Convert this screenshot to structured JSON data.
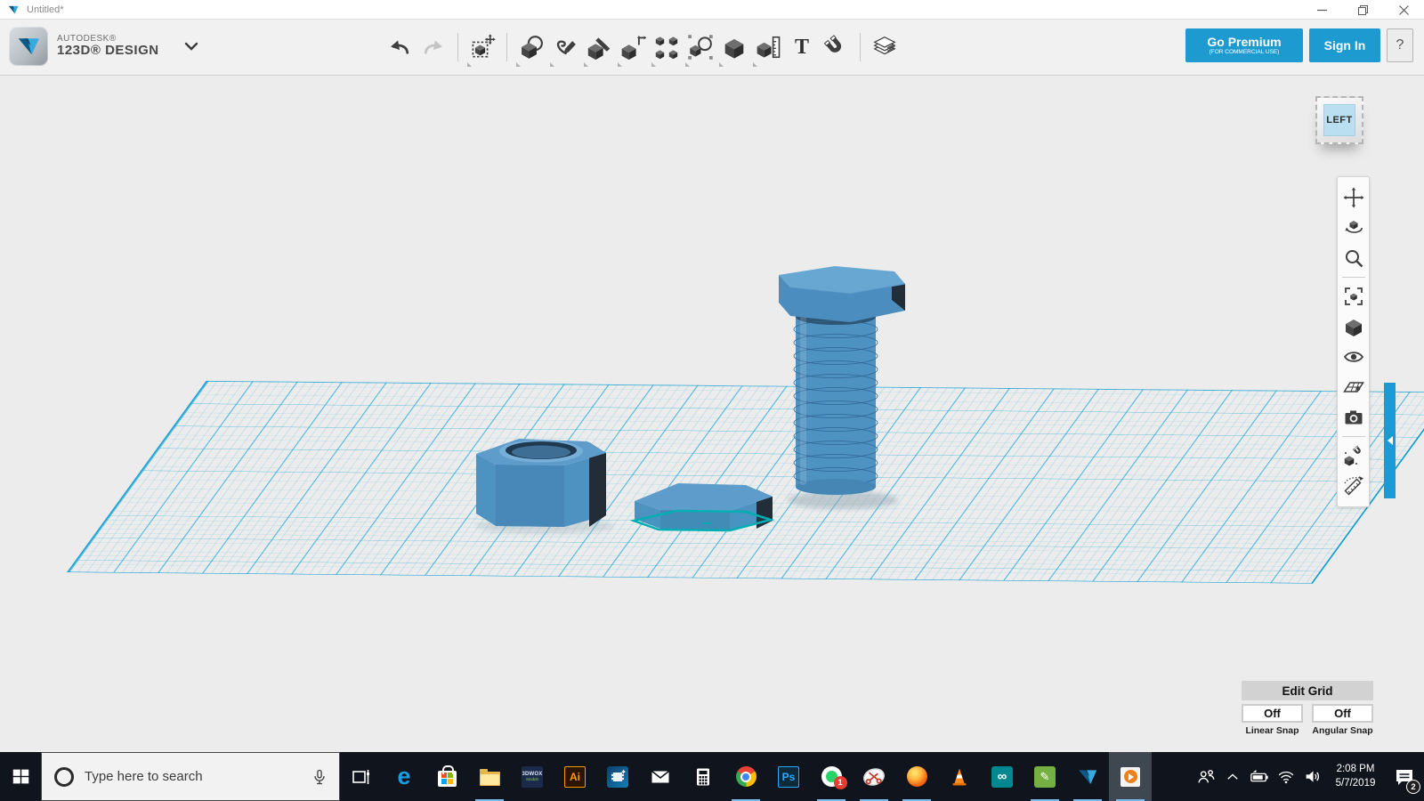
{
  "window": {
    "title": "Untitled*",
    "controls": [
      "minimize",
      "restore",
      "close"
    ]
  },
  "brand": {
    "autodesk": "AUTODESK®",
    "product": "123D® DESIGN"
  },
  "account": {
    "go_premium": "Go Premium",
    "go_premium_sub": "(FOR COMMERCIAL USE)",
    "sign_in": "Sign In",
    "help": "?"
  },
  "toolbar": {
    "text_tool_glyph": "T",
    "tools": [
      "undo",
      "redo",
      "transform",
      "primitives",
      "sketch",
      "construct",
      "modify",
      "pattern",
      "grouping",
      "combine",
      "measure",
      "text",
      "snap",
      "materials"
    ]
  },
  "viewport": {
    "view_cube": "LEFT",
    "nav_tools": [
      "pan",
      "orbit",
      "zoom",
      "fit-view",
      "shading",
      "hide",
      "grid-visibility",
      "screenshot",
      "snap-objects",
      "measure"
    ],
    "objects": [
      "hex-nut",
      "hex-blank-selected",
      "hex-bolt"
    ],
    "colors": {
      "background": "#ECECEC",
      "grid_line": "#00A0D7",
      "model_blue": "#4E92C2",
      "model_top": "#69A7D3",
      "model_dark_face": "#222D38",
      "selection_teal": "#00AEB4",
      "accent_blue": "#1D9BD1"
    }
  },
  "grid_controls": {
    "edit_grid": "Edit Grid",
    "linear_snap": {
      "value": "Off",
      "label": "Linear Snap"
    },
    "angular_snap": {
      "value": "Off",
      "label": "Angular Snap"
    }
  },
  "taskbar": {
    "search": {
      "placeholder": "Type here to search"
    },
    "apps": [
      "task-view",
      "edge",
      "microsoft-store",
      "file-explorer",
      "3dwox-slicer",
      "adobe-illustrator",
      "video-editor",
      "mail",
      "calculator",
      "chrome",
      "photoshop",
      "whatsapp",
      "snipping-tool",
      "firefox",
      "vlc",
      "arduino",
      "coreldraw",
      "123d-design",
      "windows-media-player"
    ],
    "active_apps": [
      "file-explorer",
      "chrome",
      "whatsapp",
      "snipping-tool",
      "firefox",
      "coreldraw",
      "123d-design",
      "windows-media-player"
    ],
    "labels": {
      "threedwox_line1": "3DWOX",
      "threedwox_line2": "Sindoh",
      "illustrator": "Ai",
      "photoshop": "Ps",
      "arduino": "∞",
      "pen_glyph": "✎",
      "edge_glyph": "e"
    },
    "badges": {
      "whatsapp": "1",
      "notifications": "2"
    },
    "tray": {
      "time": "2:08 PM",
      "date": "5/7/2019",
      "icons": [
        "people",
        "chevron-up",
        "battery",
        "wifi",
        "volume",
        "action-center"
      ]
    }
  }
}
